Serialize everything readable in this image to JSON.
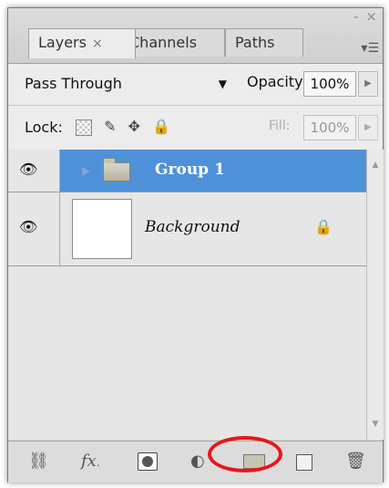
{
  "window": {
    "controls": {
      "minimize": "-",
      "close": "×"
    }
  },
  "tabs": [
    {
      "label": "Layers",
      "close": "×",
      "active": true
    },
    {
      "label": "Channels",
      "active": false
    },
    {
      "label": "Paths",
      "active": false
    }
  ],
  "panel_menu_icon": "panel-menu-icon",
  "blend_mode": {
    "value": "Pass Through"
  },
  "opacity": {
    "label": "Opacity:",
    "value": "100%"
  },
  "lock": {
    "label": "Lock:",
    "icons": [
      "lock-transparent-icon",
      "lock-paint-brush-icon",
      "lock-position-icon",
      "lock-all-icon"
    ]
  },
  "fill": {
    "label": "Fill:",
    "value": "100%"
  },
  "layers": [
    {
      "name": "Group 1",
      "type": "group",
      "visible": true,
      "selected": true
    },
    {
      "name": "Background",
      "type": "layer",
      "visible": true,
      "locked": true
    }
  ],
  "bottom_icons": [
    "link-layers-icon",
    "fx-icon",
    "add-mask-icon",
    "adjustment-layer-icon",
    "new-group-icon",
    "new-layer-icon",
    "delete-layer-icon"
  ],
  "bottom_labels": {
    "fx": "fx"
  },
  "colors": {
    "selection": "#4f91d9",
    "highlight_ring": "#e8141c"
  }
}
